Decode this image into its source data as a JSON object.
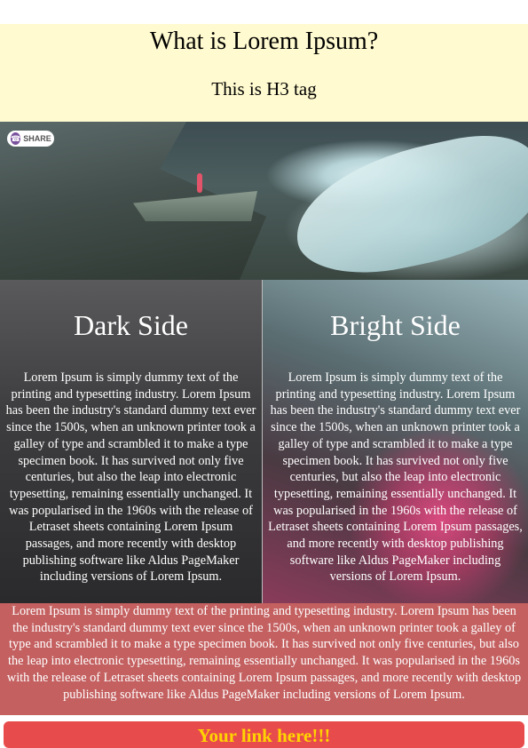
{
  "header": {
    "title": "What is Lorem Ipsum?",
    "subtitle": "This is H3 tag"
  },
  "share": {
    "label": "SHARE",
    "icon": "viber-icon",
    "icon_color": "#7b519d"
  },
  "panels": [
    {
      "heading": "Dark Side",
      "body": "Lorem Ipsum is simply dummy text of the printing and typesetting industry. Lorem Ipsum has been the industry's standard dummy text ever since the 1500s, when an unknown printer took a galley of type and scrambled it to make a type specimen book. It has survived not only five centuries, but also the leap into electronic typesetting, remaining essentially unchanged. It was popularised in the 1960s with the release of Letraset sheets containing Lorem Ipsum passages, and more recently with desktop publishing software like Aldus PageMaker including versions of Lorem Ipsum."
    },
    {
      "heading": "Bright Side",
      "body": "Lorem Ipsum is simply dummy text of the printing and typesetting industry. Lorem Ipsum has been the industry's standard dummy text ever since the 1500s, when an unknown printer took a galley of type and scrambled it to make a type specimen book. It has survived not only five centuries, but also the leap into electronic typesetting, remaining essentially unchanged. It was popularised in the 1960s with the release of Letraset sheets containing Lorem Ipsum passages, and more recently with desktop publishing software like Aldus PageMaker including versions of Lorem Ipsum."
    }
  ],
  "footer": {
    "body": "Lorem Ipsum is simply dummy text of the printing and typesetting industry. Lorem Ipsum has been the industry's standard dummy text ever since the 1500s, when an unknown printer took a galley of type and scrambled it to make a type specimen book. It has survived not only five centuries, but also the leap into electronic typesetting, remaining essentially unchanged. It was popularised in the 1960s with the release of Letraset sheets containing Lorem Ipsum passages, and more recently with desktop publishing software like Aldus PageMaker including versions of Lorem Ipsum.",
    "link_label": "Your link here!!!"
  },
  "colors": {
    "header_bg": "#fffacf",
    "footer_bg": "#c46060",
    "link_bg": "#e84b4b",
    "link_text": "#ffd400"
  }
}
